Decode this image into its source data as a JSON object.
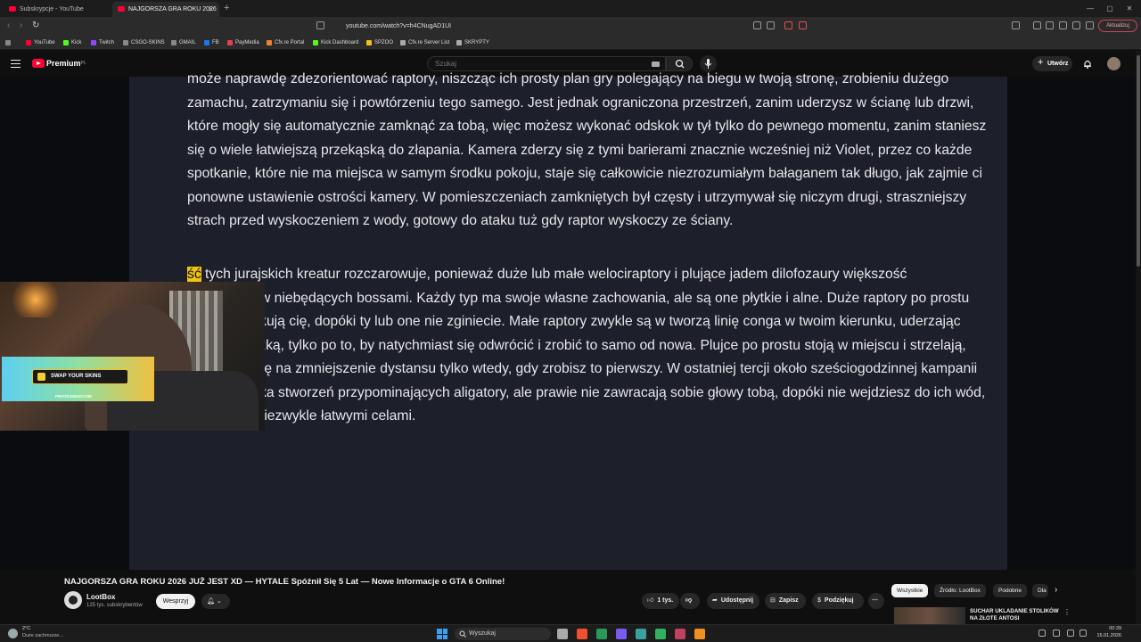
{
  "browser": {
    "tabs": [
      {
        "title": "Subskrypcje - YouTube",
        "active": false
      },
      {
        "title": "NAJGORSZA GRA ROKU 2026",
        "active": true
      }
    ],
    "url": "youtube.com/watch?v=h4CNugAD1UI",
    "update_label": "Aktualizuj",
    "bookmarks": [
      {
        "label": "YouTube",
        "color": "#ff0033"
      },
      {
        "label": "Kick",
        "color": "#53fc18"
      },
      {
        "label": "Twitch",
        "color": "#9146ff"
      },
      {
        "label": "CSGO-SKINS",
        "color": "#888888"
      },
      {
        "label": "GMAIL",
        "color": "#888888"
      },
      {
        "label": "FB",
        "color": "#1877f2"
      },
      {
        "label": "PayMedia",
        "color": "#e04050"
      },
      {
        "label": "Cfx.re Portal",
        "color": "#f08030"
      },
      {
        "label": "Kick Dashboard",
        "color": "#53fc18"
      },
      {
        "label": "SPZOO",
        "color": "#f0c020"
      },
      {
        "label": "Cfx.re Server List",
        "color": "#aaaaaa"
      },
      {
        "label": "SKRYPTY",
        "color": "#aaaaaa"
      }
    ]
  },
  "youtube": {
    "logo_label": "Premium",
    "logo_region": "PL",
    "search_placeholder": "Szukaj",
    "create_label": "Utwórz"
  },
  "article": {
    "p1": "może naprawdę zdezorientować raptory, niszcząc ich prosty plan gry polegający na biegu w twoją stronę, zrobieniu dużego zamachu, zatrzymaniu się i powtórzeniu tego samego. Jest jednak ograniczona przestrzeń, zanim uderzysz w ścianę lub drzwi, które mogły się automatycznie zamknąć za tobą, więc możesz wykonać odskok w tył tylko do pewnego momentu, zanim staniesz się o wiele łatwiejszą przekąską do złapania. Kamera zderzy się z tymi barierami znacznie wcześniej niż Violet, przez co każde spotkanie, które nie ma miejsca w samym środku pokoju, staje się całkowicie niezrozumiałym bałaganem tak długo, jak zajmie ci ponowne ustawienie ostrości kamery. W pomieszczeniach zamkniętych był częsty i utrzymywał się niczym drugi, straszniejszy strach przed wyskoczeniem z wody, gotowy do ataku tuż gdy raptor wyskoczy ze ściany.",
    "p2_highlight": "ść",
    "p2_rest": " tych jurajskich kreatur rozczarowuje, ponieważ duże lub małe welociraptory i plujące jadem dilofozaury większość przeciwników niebędących bossami. Każdy typ ma swoje własne zachowania, ale są one płytkie i alne. Duże raptory po prostu biegną i atakują cię, dopóki ty lub one nie zginiecie. Małe raptory zwykle są w tworzą linię conga w twoim kierunku, uderzając przed ucieczką, tylko po to, by natychmiast się odwrócić i zrobić to samo od nowa. Plujce po prostu stoją w miejscu i strzelają, decydując się na zmniejszenie dystansu tylko wtedy, gdy zrobisz to pierwszy. W ostatniej tercji około sześciogodzinnej kampanii spotkasz kilka stworzeń przypominających aligatory, ale prawie nie zawracają sobie głowy tobą, dopóki nie wejdziesz do ich wód, co czyni je niezwykle łatwymi celami."
  },
  "ad": {
    "cta": "SWAP YOUR SKINS",
    "url": "PIRATESWAP.COM"
  },
  "video": {
    "title": "NAJGORSZA GRA ROKU 2026 JUŻ JEST XD — HYTALE Spóźnił Się 5 Lat — Nowe Informacje o GTA 6 Online!",
    "channel": "LootBox",
    "subscribers": "125 tys. subskrybentów",
    "support_label": "Wesprzyj",
    "likes": "1 tys.",
    "share_label": "Udostępnij",
    "save_label": "Zapisz",
    "thanks_label": "Podziękuj"
  },
  "related": {
    "chips": [
      {
        "label": "Wszystkie",
        "active": true
      },
      {
        "label": "Źródło: LootBox",
        "active": false
      },
      {
        "label": "Podobne",
        "active": false
      },
      {
        "label": "Dla",
        "active": false
      }
    ],
    "first_title": "SUCHAR UKLADANIE STOLIKÓW NA ZŁOTE ANTOSI"
  },
  "taskbar": {
    "weather_temp": "2°C",
    "weather_desc": "Duże zachmurze...",
    "search_label": "Wyszukaj",
    "time": "00:39",
    "date": "15.01.2026"
  }
}
